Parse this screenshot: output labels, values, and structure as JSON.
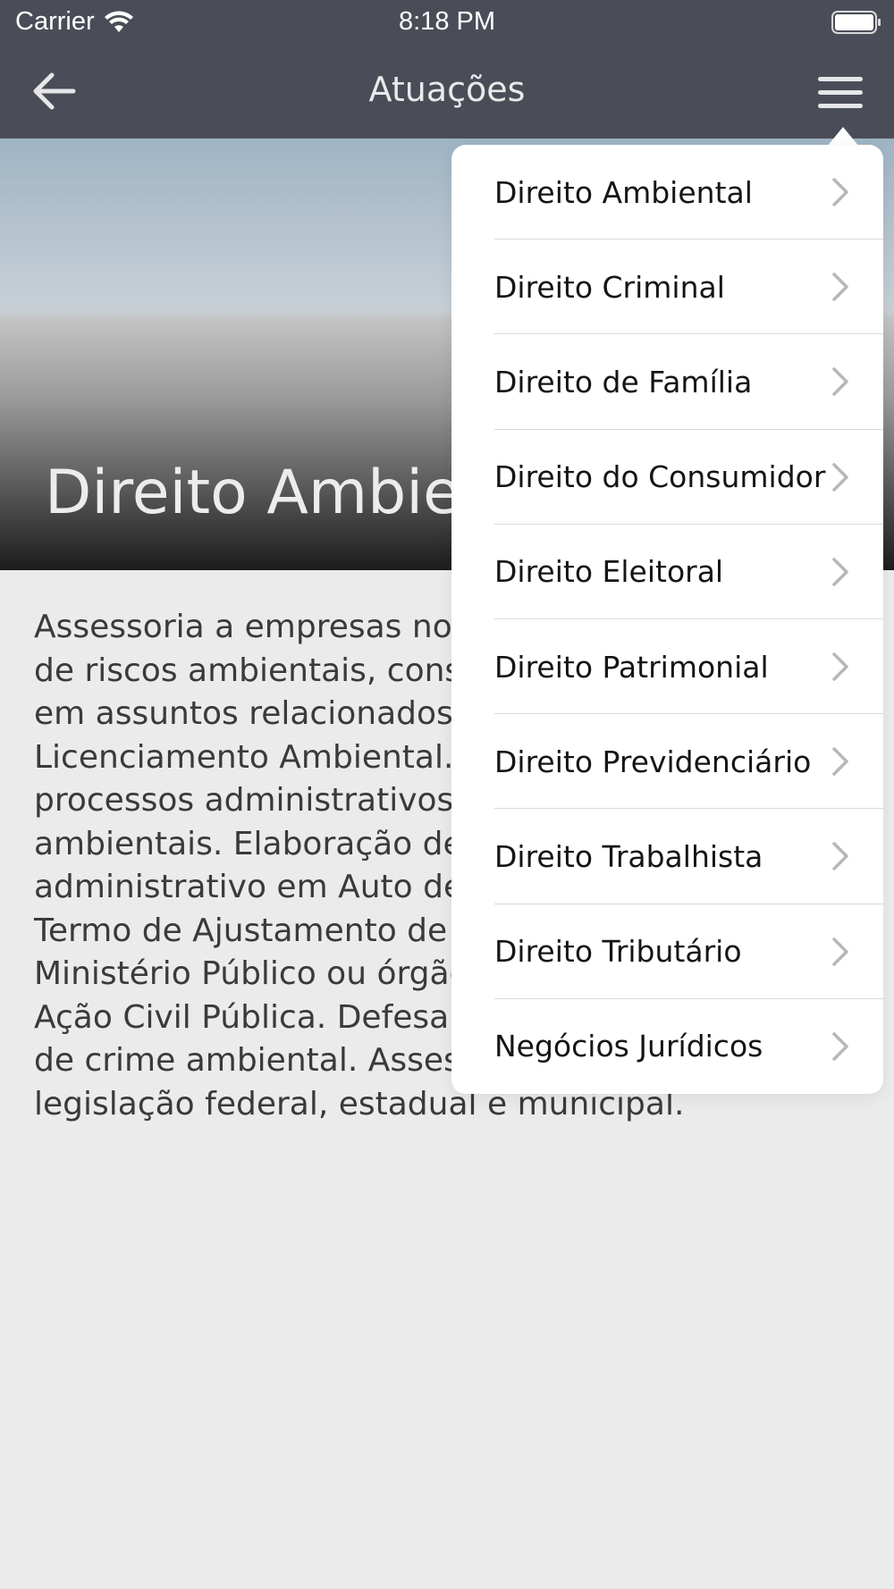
{
  "status_bar": {
    "carrier": "Carrier",
    "time": "8:18 PM"
  },
  "nav": {
    "title": "Atuações",
    "back_icon": "arrow-left-icon",
    "menu_icon": "hamburger-menu-icon"
  },
  "hero": {
    "title": "Direito Ambiental"
  },
  "content": {
    "lines": [
      "Assessoria a empresas no gerenciamento",
      "de riscos ambientais, consultoria jurídica",
      "em assuntos relacionados ao",
      "Licenciamento Ambiental. Atuação em",
      "processos administrativos e judiciais",
      "ambientais. Elaboração de defesa e recurso",
      "administrativo em Auto de Infração.",
      "Termo de Ajustamento de Conduta com o",
      "Ministério Público ou órgão ambiental.",
      "Ação Civil Pública. Defesa em processos",
      "de crime ambiental. Assessoria quanto à",
      "legislação federal, estadual e municipal."
    ]
  },
  "menu": {
    "items": [
      {
        "label": "Direito Ambiental"
      },
      {
        "label": "Direito Criminal"
      },
      {
        "label": "Direito de Família"
      },
      {
        "label": "Direito do Consumidor"
      },
      {
        "label": "Direito Eleitoral"
      },
      {
        "label": "Direito Patrimonial"
      },
      {
        "label": "Direito Previdenciário"
      },
      {
        "label": "Direito Trabalhista"
      },
      {
        "label": "Direito Tributário"
      },
      {
        "label": "Negócios Jurídicos"
      }
    ]
  },
  "colors": {
    "header_bg": "#4a4d57",
    "page_bg": "#ebebeb",
    "menu_bg": "#ffffff"
  }
}
